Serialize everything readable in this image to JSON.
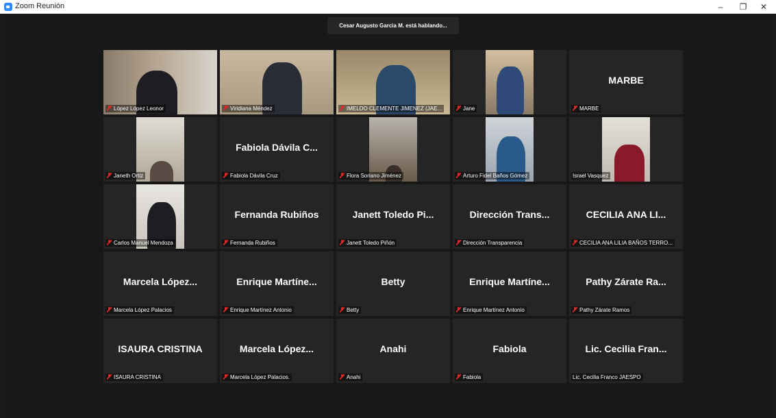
{
  "window": {
    "title": "Zoom Reunión",
    "minimize": "–",
    "maximize": "❐",
    "close": "✕"
  },
  "speaker_banner": "Cesar Augusto Garcia M. está hablando...",
  "tiles": [
    {
      "display": "",
      "label": "López López Leonor",
      "muted": true,
      "video": true
    },
    {
      "display": "",
      "label": "Viridiana Méndez",
      "muted": true,
      "video": true
    },
    {
      "display": "",
      "label": "IMELDO CLEMENTE JIMENEZ (JAE...",
      "muted": true,
      "video": true
    },
    {
      "display": "",
      "label": "Jane",
      "muted": true,
      "video": true
    },
    {
      "display": "MARBE",
      "label": "MARBE",
      "muted": true,
      "video": false
    },
    {
      "display": "",
      "label": "Janeth Ortiz",
      "muted": true,
      "video": true
    },
    {
      "display": "Fabiola Dávila C...",
      "label": "Fabiola Dávila Cruz",
      "muted": true,
      "video": false
    },
    {
      "display": "",
      "label": "Flora Soriano Jiménez",
      "muted": true,
      "video": true
    },
    {
      "display": "",
      "label": "Arturo Fidel Baños Gómez",
      "muted": true,
      "video": true
    },
    {
      "display": "",
      "label": "Israel Vasquez",
      "muted": false,
      "video": true
    },
    {
      "display": "",
      "label": "Carlos Manuel Mendoza",
      "muted": true,
      "video": true
    },
    {
      "display": "Fernanda Rubiños",
      "label": "Fernanda Rubiños",
      "muted": true,
      "video": false
    },
    {
      "display": "Janett Toledo Pi...",
      "label": "Janett Toledo Piñón",
      "muted": true,
      "video": false
    },
    {
      "display": "Dirección Trans...",
      "label": "Dirección Transparencia",
      "muted": true,
      "video": false
    },
    {
      "display": "CECILIA ANA LI...",
      "label": "CECILIA ANA LILIA BAÑOS TERRO...",
      "muted": true,
      "video": false
    },
    {
      "display": "Marcela López...",
      "label": "Marcela López Palacios",
      "muted": true,
      "video": false
    },
    {
      "display": "Enrique Martíne...",
      "label": "Enrique Martínez Antonio",
      "muted": true,
      "video": false
    },
    {
      "display": "Betty",
      "label": "Betty",
      "muted": true,
      "video": false
    },
    {
      "display": "Enrique Martíne...",
      "label": "Enrique Martínez Antonio",
      "muted": true,
      "video": false
    },
    {
      "display": "Pathy Zárate Ra...",
      "label": "Pathy Zárate Ramos",
      "muted": true,
      "video": false
    },
    {
      "display": "ISAURA CRISTINA",
      "label": "ISAURA CRISTINA",
      "muted": true,
      "video": false
    },
    {
      "display": "Marcela López...",
      "label": "Marcela López Palacios.",
      "muted": true,
      "video": false
    },
    {
      "display": "Anahi",
      "label": "Anahi",
      "muted": true,
      "video": false
    },
    {
      "display": "Fabiola",
      "label": "Fabiola",
      "muted": true,
      "video": false
    },
    {
      "display": "Lic. Cecilia Fran...",
      "label": "Lic. Cecilia Franco JAESPO",
      "muted": false,
      "video": true
    }
  ]
}
